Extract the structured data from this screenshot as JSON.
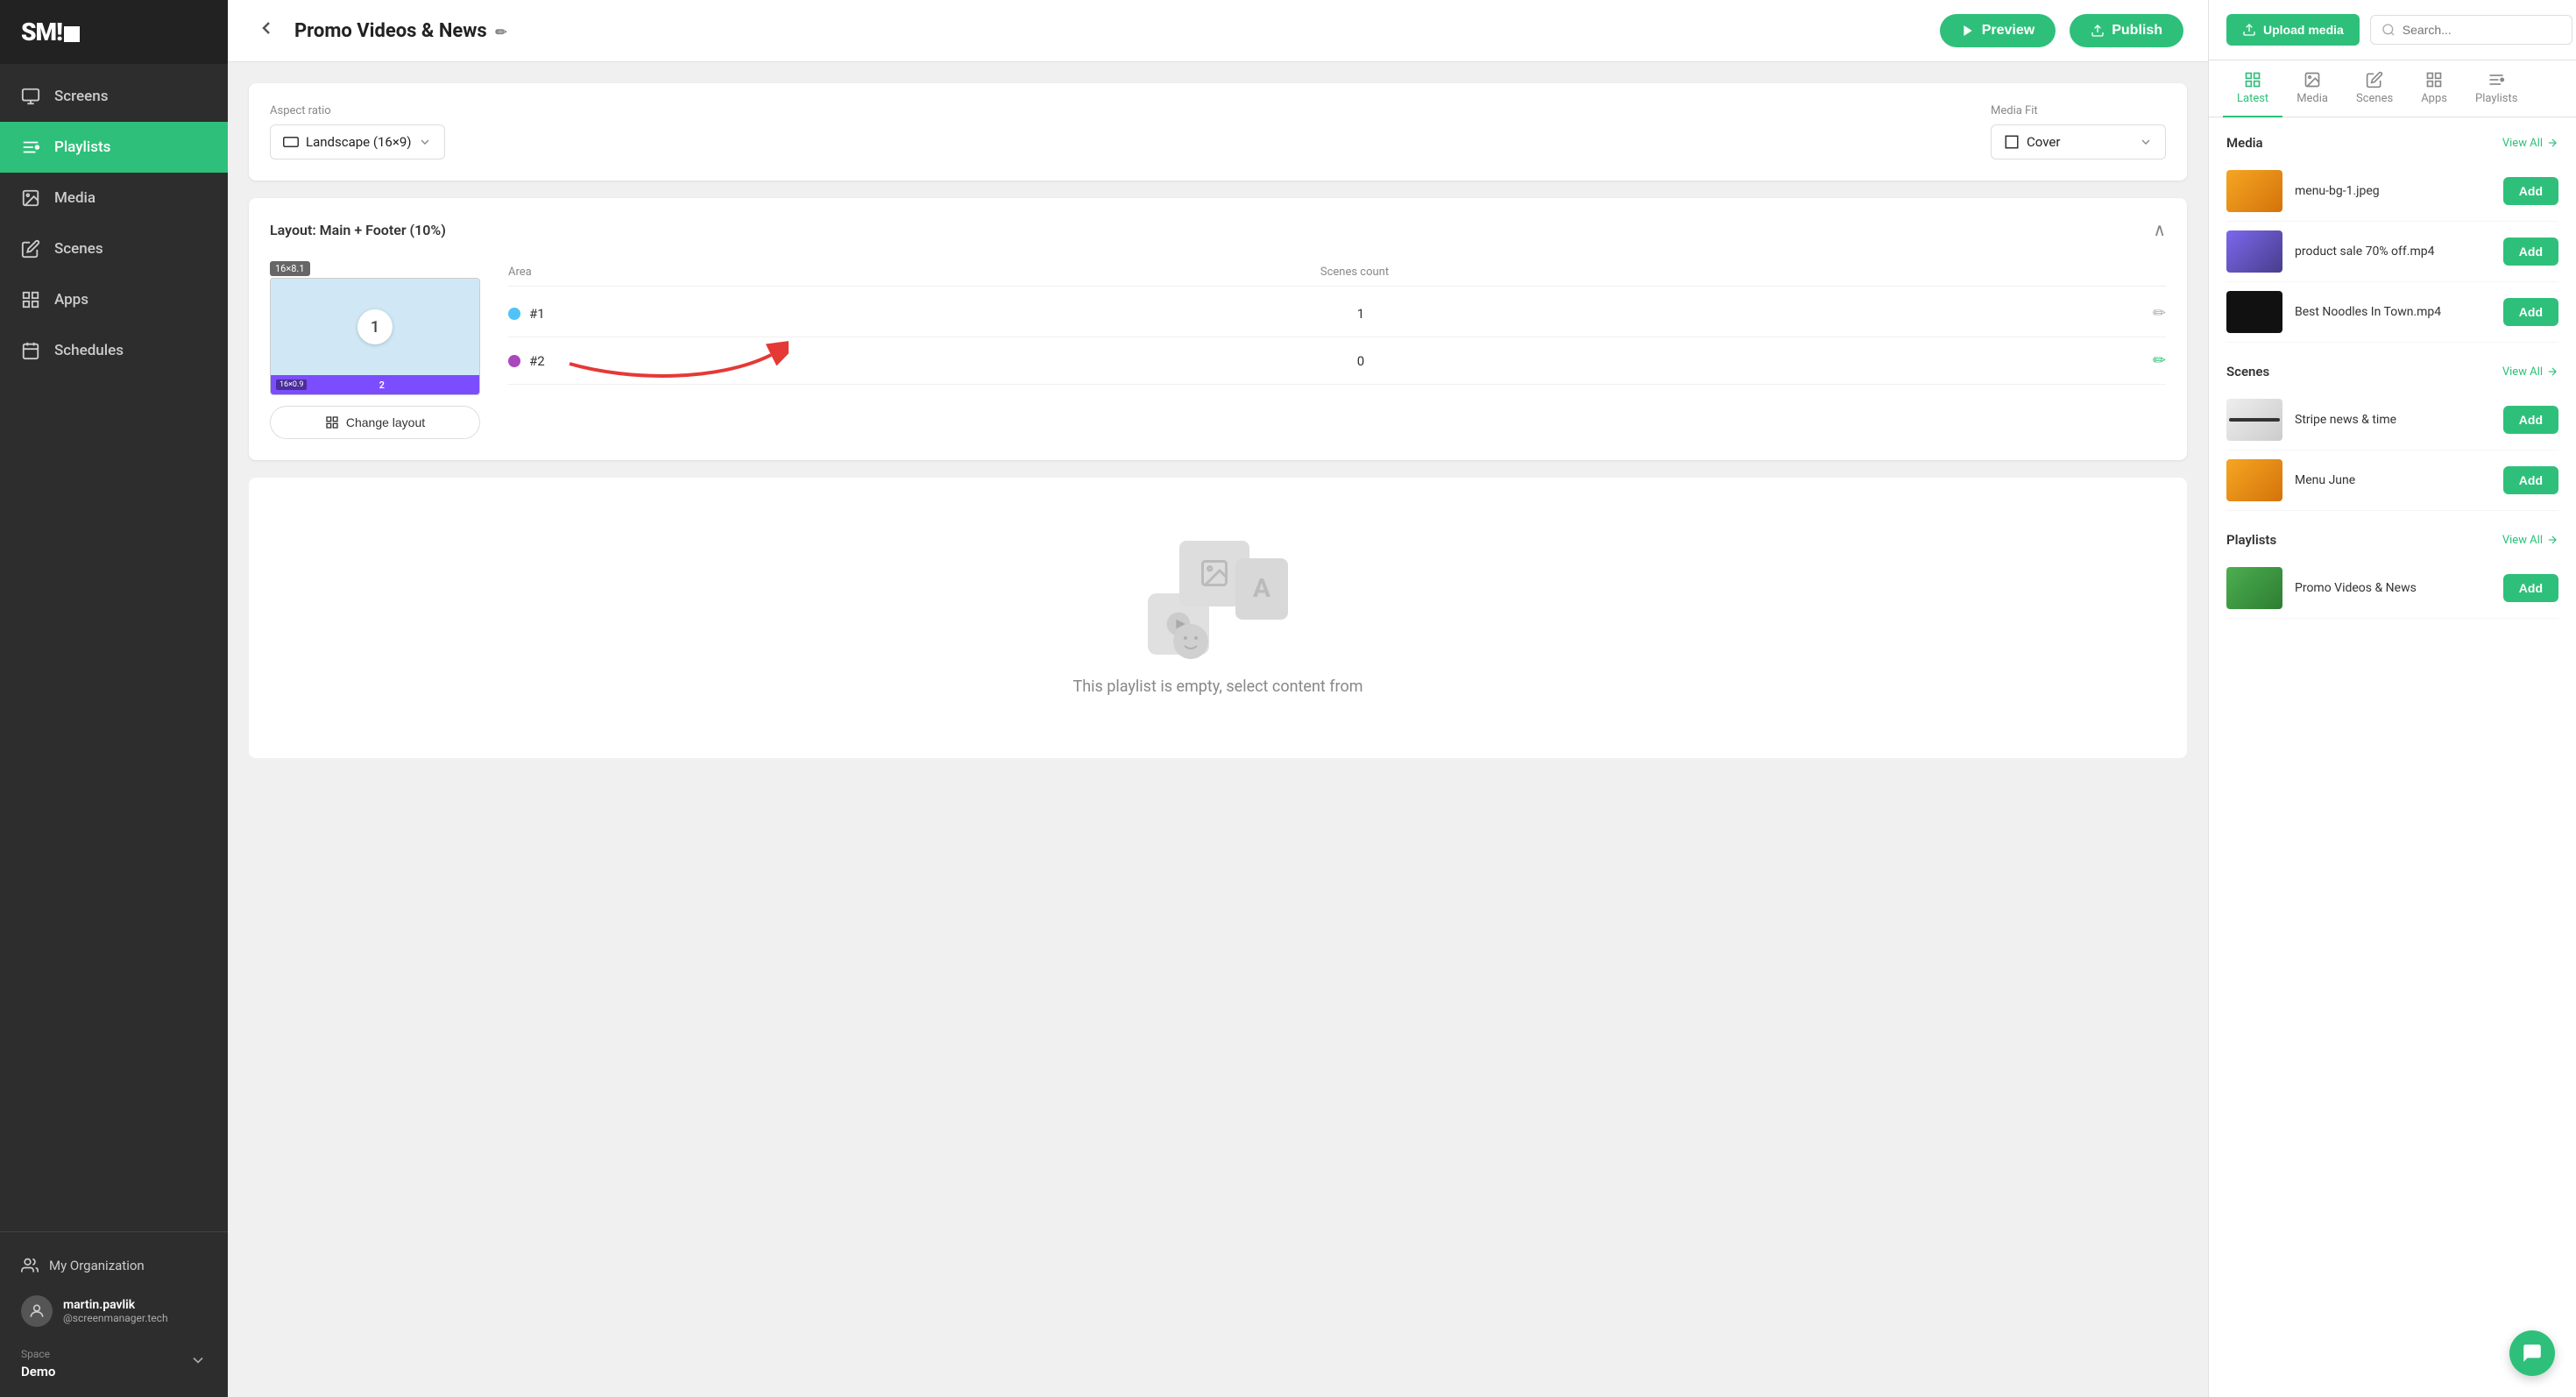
{
  "sidebar": {
    "logo": "SM!",
    "items": [
      {
        "id": "screens",
        "label": "Screens",
        "icon": "monitor"
      },
      {
        "id": "playlists",
        "label": "Playlists",
        "icon": "list",
        "active": true
      },
      {
        "id": "media",
        "label": "Media",
        "icon": "image"
      },
      {
        "id": "scenes",
        "label": "Scenes",
        "icon": "pencil"
      },
      {
        "id": "apps",
        "label": "Apps",
        "icon": "grid"
      },
      {
        "id": "schedules",
        "label": "Schedules",
        "icon": "calendar"
      }
    ],
    "my_organization": "My Organization",
    "user": {
      "name": "martin.pavlik",
      "email": "@screenmanager.tech"
    },
    "space_label": "Space",
    "space_name": "Demo"
  },
  "header": {
    "title": "Promo Videos & News",
    "back_label": "‹",
    "preview_label": "Preview",
    "publish_label": "Publish"
  },
  "settings": {
    "aspect_ratio_label": "Aspect ratio",
    "aspect_ratio_value": "Landscape (16×9)",
    "media_fit_label": "Media Fit",
    "media_fit_value": "Cover"
  },
  "layout": {
    "title": "Layout: Main + Footer (10%)",
    "area_label": "Area",
    "scenes_count_label": "Scenes count",
    "areas": [
      {
        "id": 1,
        "dot_color": "#4fc3f7",
        "label": "#1",
        "count": 1
      },
      {
        "id": 2,
        "dot_color": "#ab47bc",
        "label": "#2",
        "count": 0
      }
    ],
    "change_layout_label": "Change layout",
    "badge_main": "16×8.1",
    "badge_footer": "16×0.9"
  },
  "empty_state": {
    "text": "This playlist is empty, select content from"
  },
  "right_panel": {
    "upload_label": "Upload media",
    "search_placeholder": "Search...",
    "tabs": [
      {
        "id": "latest",
        "label": "Latest",
        "icon": "grid2"
      },
      {
        "id": "media",
        "label": "Media",
        "icon": "image"
      },
      {
        "id": "scenes",
        "label": "Scenes",
        "icon": "pencil"
      },
      {
        "id": "apps",
        "label": "Apps",
        "icon": "grid"
      },
      {
        "id": "playlists",
        "label": "Playlists",
        "icon": "list"
      }
    ],
    "active_tab": "latest",
    "media_section": {
      "title": "Media",
      "view_all": "View All",
      "items": [
        {
          "id": 1,
          "name": "menu-bg-1.jpeg",
          "thumb": "thumb-bg-1"
        },
        {
          "id": 2,
          "name": "product sale 70% off.mp4",
          "thumb": "thumb-bg-2"
        },
        {
          "id": 3,
          "name": "Best Noodles In Town.mp4",
          "thumb": "thumb-bg-3"
        }
      ]
    },
    "scenes_section": {
      "title": "Scenes",
      "view_all": "View All",
      "items": [
        {
          "id": 1,
          "name": "Stripe news & time",
          "thumb": "thumb-bg-4"
        },
        {
          "id": 2,
          "name": "Menu June",
          "thumb": "thumb-bg-5"
        }
      ]
    },
    "playlists_section": {
      "title": "Playlists",
      "view_all": "View All",
      "items": [
        {
          "id": 1,
          "name": "Promo Videos & News",
          "thumb": "thumb-bg-6"
        }
      ]
    }
  }
}
